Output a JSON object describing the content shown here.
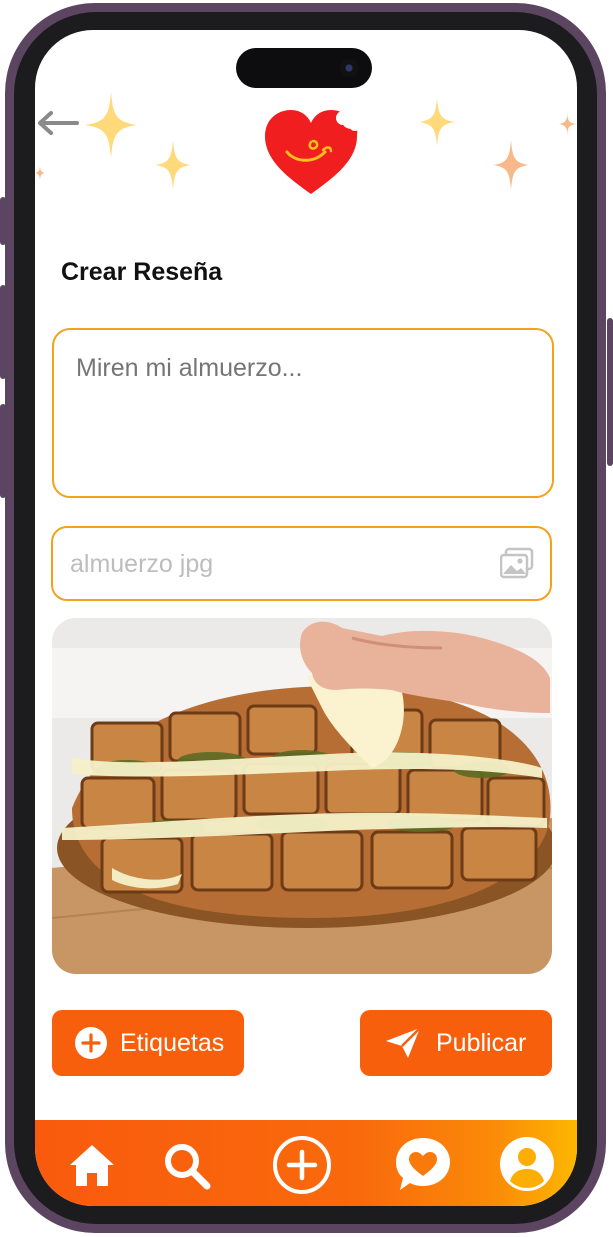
{
  "header": {
    "back_icon": "arrow-left-icon",
    "logo_icon": "heart-bite-logo-icon"
  },
  "page": {
    "title": "Crear Reseña"
  },
  "form": {
    "review_placeholder": "Miren mi almuerzo...",
    "attachment_name": "almuerzo jpg",
    "attachment_icon": "image-gallery-icon",
    "preview_image": "food-photo-cheesy-pull-apart-bread"
  },
  "actions": {
    "tags_label": "Etiquetas",
    "tags_icon": "plus-circle-icon",
    "publish_label": "Publicar",
    "publish_icon": "send-icon"
  },
  "bottom_nav": {
    "items": [
      "home-icon",
      "search-icon",
      "add-icon",
      "chat-heart-icon",
      "user-icon"
    ]
  },
  "colors": {
    "accent": "#f85f0c",
    "input_border": "#f3a21a",
    "logo_red": "#f01e1e",
    "sparkle_yellow": "#ffd97a",
    "sparkle_peach": "#f8b98a"
  }
}
